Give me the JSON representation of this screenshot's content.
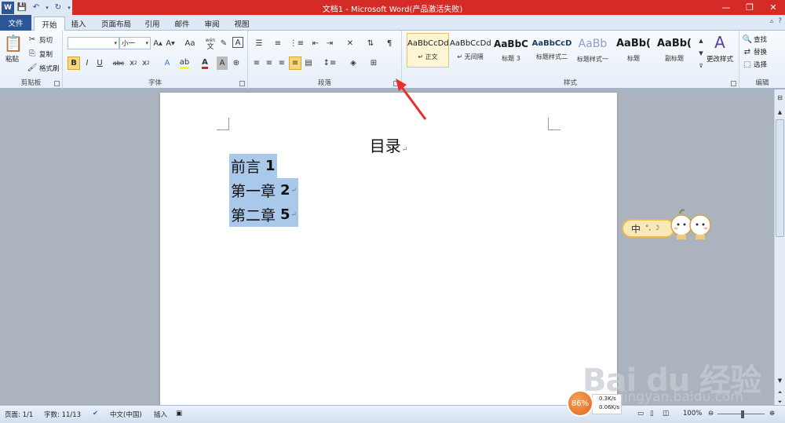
{
  "window": {
    "title": "文档1 - Microsoft Word(产品激活失败)"
  },
  "qat": {
    "icons": [
      "word-logo-icon",
      "save-icon",
      "undo-icon",
      "redo-icon",
      "customize-icon"
    ]
  },
  "tabs": [
    {
      "label": "文件"
    },
    {
      "label": "开始"
    },
    {
      "label": "插入"
    },
    {
      "label": "页面布局"
    },
    {
      "label": "引用"
    },
    {
      "label": "邮件"
    },
    {
      "label": "审阅"
    },
    {
      "label": "视图"
    }
  ],
  "ribbon": {
    "clipboard": {
      "group_label": "剪贴板",
      "paste_label": "粘贴",
      "cut_label": "剪切",
      "copy_label": "复制",
      "format_painter_label": "格式刷"
    },
    "font": {
      "group_label": "字体",
      "font_name": "",
      "font_size": "小一",
      "grow": "A",
      "shrink": "A",
      "case": "Aa",
      "bold": "B",
      "italic": "I",
      "underline": "U",
      "strike": "abc",
      "sub": "x",
      "sup": "x",
      "font_color": "A",
      "char_border": "A",
      "wen": "文",
      "pinyin": "wén"
    },
    "paragraph": {
      "group_label": "段落"
    },
    "styles": {
      "group_label": "样式",
      "change_styles_label": "更改样式",
      "items": [
        {
          "sample": "AaBbCcDd",
          "name": "↵ 正文",
          "selected": true
        },
        {
          "sample": "AaBbCcDd",
          "name": "↵ 无间隔",
          "selected": false
        },
        {
          "sample": "AaBbC",
          "name": "标题 3",
          "selected": false
        },
        {
          "sample": "AaBbCcD",
          "name": "标题样式二",
          "selected": false
        },
        {
          "sample": "AaBb",
          "name": "标题样式一",
          "selected": false
        },
        {
          "sample": "AaBb(",
          "name": "标题",
          "selected": false
        },
        {
          "sample": "AaBb(",
          "name": "副标题",
          "selected": false
        }
      ]
    },
    "editing": {
      "group_label": "编辑",
      "find_label": "查找",
      "replace_label": "替换",
      "select_label": "选择"
    }
  },
  "document": {
    "title": "目录",
    "toc": [
      {
        "text": "前言",
        "page": "1"
      },
      {
        "text": "第一章",
        "page": "2"
      },
      {
        "text": "第二章",
        "page": "5"
      }
    ]
  },
  "ime": {
    "char": "中",
    "status_icons": "°, ☽"
  },
  "statusbar": {
    "page": "页面: 1/1",
    "words": "字数: 11/13",
    "language": "中文(中国)",
    "insert": "插入",
    "zoom": "100%"
  },
  "netmon": {
    "percent": "86%",
    "up": "0.3K/s",
    "down": "0.06K/s"
  },
  "watermark": {
    "brand": "Bai du 经验",
    "url": "jingyan.baidu.com"
  },
  "colors": {
    "title_bar": "#d42b27",
    "file_tab": "#2b5797",
    "selection": "#a9c8ea",
    "arrow": "#e8302a"
  }
}
